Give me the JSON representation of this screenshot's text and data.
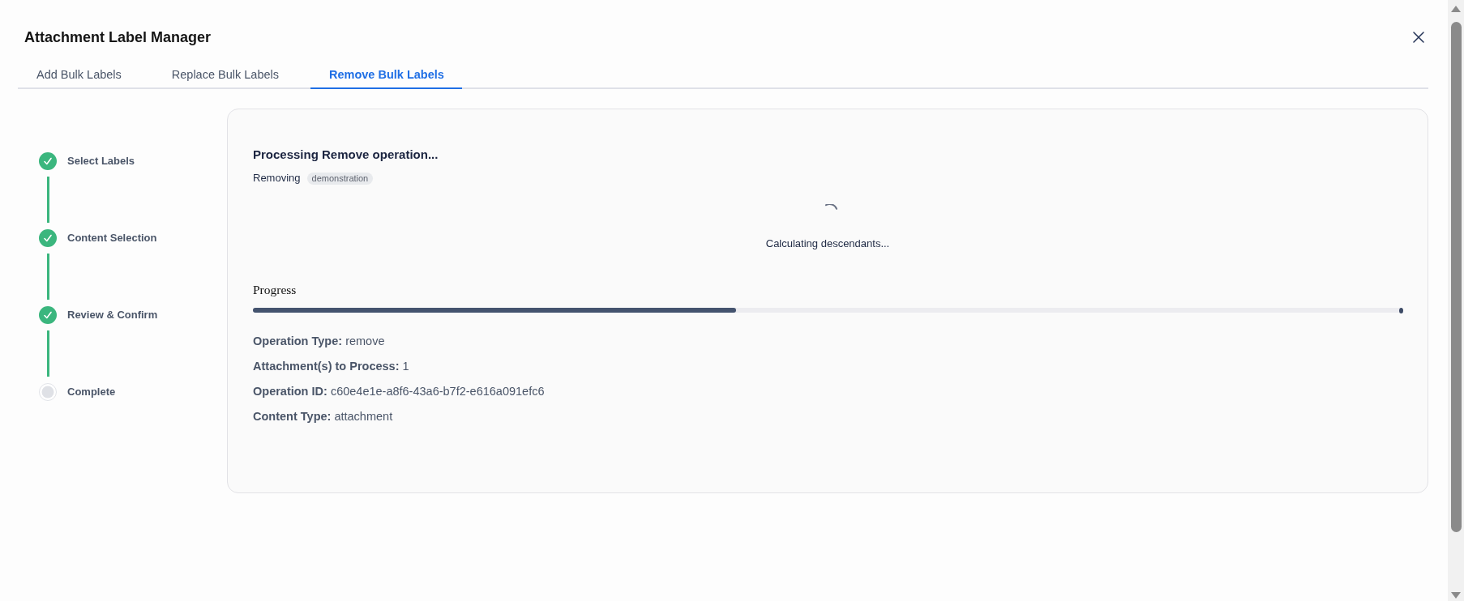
{
  "dialog": {
    "title": "Attachment Label Manager"
  },
  "tabs": [
    {
      "label": "Add Bulk Labels",
      "selected": false
    },
    {
      "label": "Replace Bulk Labels",
      "selected": false
    },
    {
      "label": "Remove Bulk Labels",
      "selected": true
    }
  ],
  "steps": [
    {
      "label": "Select Labels",
      "completed": true
    },
    {
      "label": "Content Selection",
      "completed": true
    },
    {
      "label": "Review & Confirm",
      "completed": true
    },
    {
      "label": "Complete",
      "completed": false
    }
  ],
  "operation": {
    "heading": "Processing Remove operation...",
    "action": "Removing",
    "labels": [
      "demonstration"
    ],
    "status": "Calculating descendants...",
    "progress": {
      "label": "Progress",
      "level": 0.42
    },
    "details": [
      {
        "label": "Operation Type:",
        "value": "remove"
      },
      {
        "label": "Attachment(s) to Process:",
        "value": "1"
      },
      {
        "label": "Operation ID:",
        "value": "c60e4e1e-a8f6-43a6-b7f2-e616a091efc6"
      },
      {
        "label": "Content Type:",
        "value": "attachment"
      }
    ]
  }
}
